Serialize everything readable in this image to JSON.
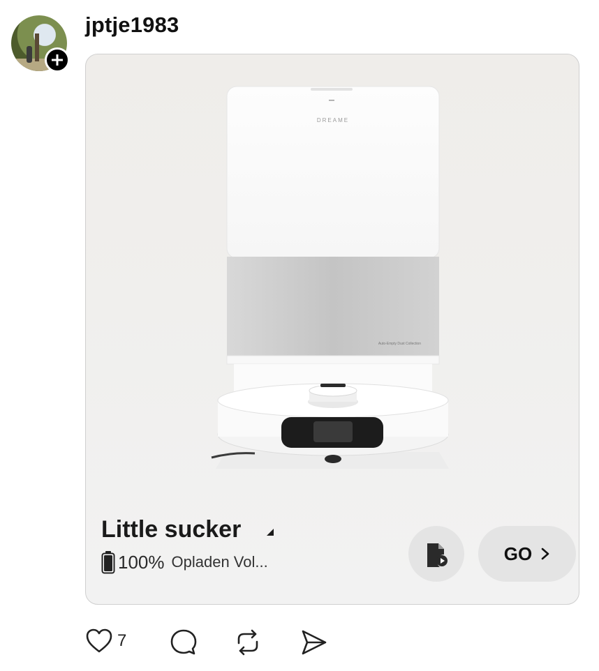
{
  "post": {
    "username": "jptje1983",
    "likes": "7"
  },
  "device": {
    "name": "Little sucker",
    "battery": "100%",
    "status": "Opladen Vol...",
    "brand_print": "DREAME",
    "dock_print": "Auto-Empty Dust Collection"
  },
  "buttons": {
    "go_label": "GO"
  },
  "colors": {
    "button_bg": "#e4e4e4",
    "text": "#111111"
  },
  "icons": {
    "follow": "plus-icon",
    "shortcut": "document-play-icon",
    "like": "heart-icon",
    "comment": "comment-icon",
    "repost": "repost-icon",
    "share": "send-icon"
  }
}
